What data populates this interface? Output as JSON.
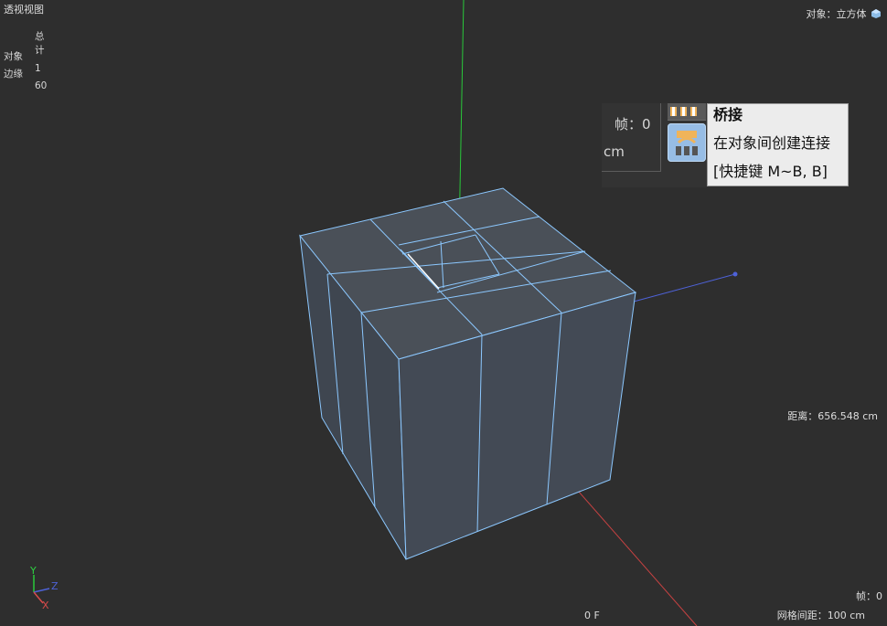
{
  "viewport": {
    "title": "透视视图",
    "selected_object_label": "对象：立方体",
    "distance_label": "距离：656.548 cm",
    "frame_label": "帧：0",
    "grid_spacing_label": "网格间距：100 cm",
    "timeline_frame": "0 F"
  },
  "stats": {
    "header": "总计",
    "rows": [
      {
        "label": "对象",
        "value": "1"
      },
      {
        "label": "边缘",
        "value": "60"
      }
    ]
  },
  "panel": {
    "frame_label": "帧：0",
    "unit_label": "cm"
  },
  "tooltip": {
    "title": "桥接",
    "description": "在对象间创建连接",
    "shortcut": "[快捷键 M~B, B]"
  },
  "axes": {
    "x_label": "X",
    "y_label": "Y",
    "z_label": "Z"
  },
  "icons": {
    "axis_gizmo": "axis-gizmo-icon",
    "bridge_tool": "bridge-tool-icon",
    "selected_object": "cube-object-icon"
  },
  "colors": {
    "background": "#2e2e2e",
    "cube_face": "#434a55",
    "cube_edge": "#8cc8ff",
    "axis_y": "#29c83a",
    "axis_x": "#d74b4b",
    "axis_z": "#4e62d8"
  }
}
